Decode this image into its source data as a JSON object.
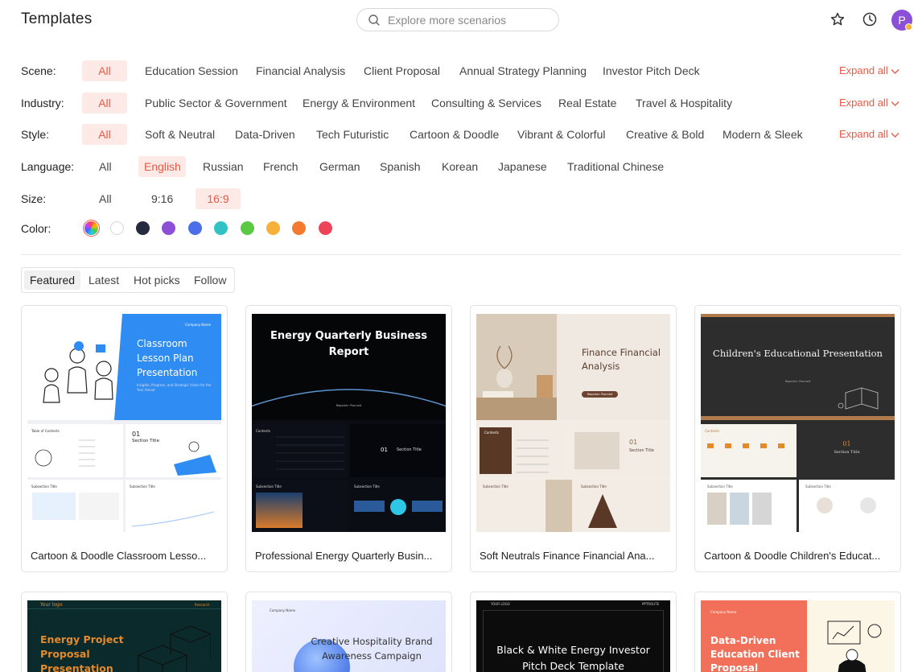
{
  "header": {
    "title": "Templates",
    "search_placeholder": "Explore more scenarios",
    "avatar_letter": "P"
  },
  "filters": {
    "scene": {
      "label": "Scene:",
      "options": [
        "All",
        "Education Session",
        "Financial Analysis",
        "Client Proposal",
        "Annual Strategy Planning",
        "Investor Pitch Deck"
      ],
      "selected": "All",
      "expand_label": "Expand all"
    },
    "industry": {
      "label": "Industry:",
      "options": [
        "All",
        "Public Sector & Government",
        "Energy & Environment",
        "Consulting & Services",
        "Real Estate",
        "Travel & Hospitality"
      ],
      "selected": "All",
      "expand_label": "Expand all"
    },
    "style": {
      "label": "Style:",
      "options": [
        "All",
        "Soft & Neutral",
        "Data-Driven",
        "Tech Futuristic",
        "Cartoon & Doodle",
        "Vibrant & Colorful",
        "Creative & Bold",
        "Modern & Sleek"
      ],
      "selected": "All",
      "expand_label": "Expand all"
    },
    "language": {
      "label": "Language:",
      "options": [
        "All",
        "English",
        "Russian",
        "French",
        "German",
        "Spanish",
        "Korean",
        "Japanese",
        "Traditional Chinese"
      ],
      "selected": "English"
    },
    "size": {
      "label": "Size:",
      "options": [
        "All",
        "9:16",
        "16:9"
      ],
      "selected": "16:9"
    },
    "color": {
      "label": "Color:",
      "swatches": [
        "rainbow",
        "#ffffff",
        "#252a3e",
        "#8b4fd8",
        "#4a6fe8",
        "#33c2c4",
        "#5cc944",
        "#f5b13a",
        "#f37a2e",
        "#ee4459"
      ],
      "selected": "rainbow"
    }
  },
  "tabs": [
    "Featured",
    "Latest",
    "Hot picks",
    "Follow"
  ],
  "active_tab": "Featured",
  "cards": [
    {
      "title": "Cartoon & Doodle Classroom Lesso...",
      "cover_heading": "Classroom Lesson Plan Presentation",
      "cover_sub": "Insights, Progress, and Strategic Vision for the Year Ahead",
      "cover_tag": "Company Name",
      "section_num": "01",
      "section_title": "Section Title",
      "toc_title": "Table of Contents",
      "subsection": "Subsection Title"
    },
    {
      "title": "Professional Energy Quarterly Busin...",
      "cover_heading": "Energy Quarterly Business Report",
      "cover_tag": "Reporter: Pionneit",
      "section_num": "01",
      "section_title": "Section Title",
      "toc_title": "Contents",
      "subsection": "Subsection Title"
    },
    {
      "title": "Soft Neutrals Finance Financial Ana...",
      "cover_heading": "Finance Financial Analysis",
      "cover_btn": "Reporter: Pionneit",
      "section_num": "01",
      "section_title": "Section Title",
      "toc_title": "Contents",
      "subsection": "Subsection Title"
    },
    {
      "title": "Cartoon & Doodle Children's Educat...",
      "cover_heading": "Children's Educational Presentation",
      "cover_tag": "Reporter: Pionneit",
      "section_num": "01",
      "section_title": "Section Title",
      "toc_title": "Contents",
      "subsection": "Subsection Title"
    }
  ],
  "cards_row2": [
    {
      "logo": "Your logo",
      "tag": "Research",
      "heading": "Energy Project Proposal Presentation"
    },
    {
      "logo": "Company Name",
      "heading": "Creative Hospitality Brand Awareness Campaign"
    },
    {
      "logo": "YOUR LOGO",
      "tag": "PPTROUTE",
      "heading": "Black & White Energy Investor Pitch Deck Template"
    },
    {
      "logo": "Company Name",
      "heading": "Data-Driven Education Client Proposal"
    }
  ],
  "colors": {
    "accent": "#e85a47",
    "accent_bg": "#fde9e6",
    "avatar": "#8b4fd8"
  }
}
